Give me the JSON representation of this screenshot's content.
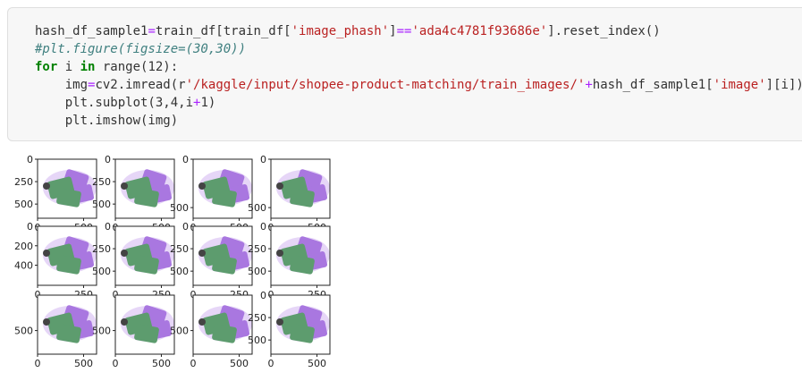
{
  "code": {
    "line1": {
      "a": "hash_df_sample1",
      "b": "=",
      "c": "train_df[train_df[",
      "d": "'image_phash'",
      "e": "]",
      "f": "==",
      "g": "'ada4c4781f93686e'",
      "h": "].reset_index()"
    },
    "line2": "#plt.figure(figsize=(30,30))",
    "line3": {
      "for": "for",
      "i": " i ",
      "in": "in",
      "rest": " range(12):"
    },
    "line4": {
      "a": "    img",
      "b": "=",
      "c": "cv2.imread(r",
      "d": "'/kaggle/input/shopee-product-matching/train_images/'",
      "e": "+",
      "f": "hash_df_sample1[",
      "g": "'image'",
      "h": "][i])"
    },
    "line5": {
      "a": "    plt.subplot(3,4,i",
      "b": "+",
      "c": "1)"
    },
    "line6": "    plt.imshow(img)"
  },
  "output": {
    "subplots": [
      {
        "yticks": [
          "0",
          "250",
          "500"
        ],
        "xticks": []
      },
      {
        "yticks": [
          "0",
          "250",
          "500"
        ],
        "xticks": []
      },
      {
        "yticks": [
          "0",
          "500"
        ],
        "xticks": []
      },
      {
        "yticks": [
          "0",
          "500"
        ],
        "xticks": []
      },
      {
        "yticks": [
          "0",
          "200",
          "400"
        ],
        "xticks": []
      },
      {
        "yticks": [
          "0",
          "250",
          "500"
        ],
        "xticks": []
      },
      {
        "yticks": [
          "0",
          "250",
          "500"
        ],
        "xticks": []
      },
      {
        "yticks": [
          "0",
          "250",
          "500"
        ],
        "xticks": []
      },
      {
        "yticks": [
          "500"
        ],
        "xticks": [
          "0",
          "500"
        ]
      },
      {
        "yticks": [
          "500"
        ],
        "xticks": [
          "0",
          "500"
        ]
      },
      {
        "yticks": [
          "500"
        ],
        "xticks": [
          "0",
          "500"
        ]
      },
      {
        "yticks": [
          "0",
          "250",
          "500"
        ],
        "xticks": [
          "0",
          "500"
        ]
      }
    ],
    "row1_xticks": [
      "0",
      "500"
    ],
    "row2_xticks": [
      "0",
      "250"
    ],
    "colors": {
      "green": "#5d9c6e",
      "purple": "#a977e0",
      "lavender": "#e6d6f7",
      "dark": "#444444"
    }
  }
}
